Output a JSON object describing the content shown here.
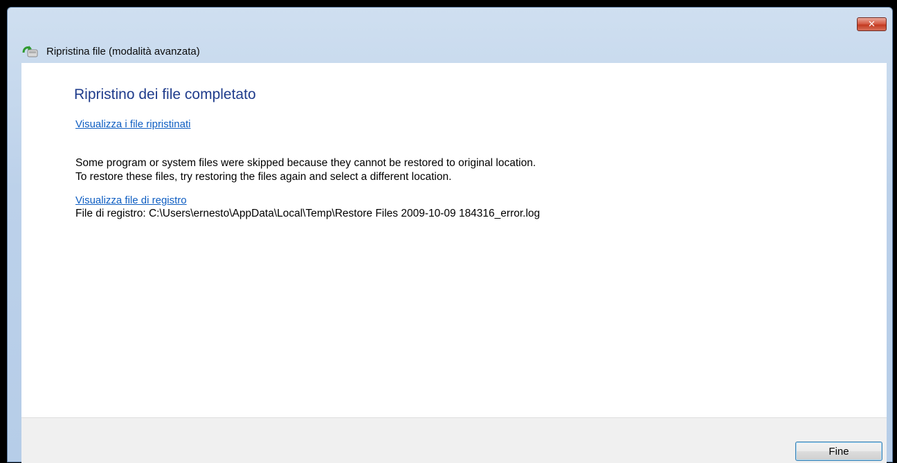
{
  "window": {
    "title": "Ripristina file (modalità avanzata)",
    "close_label": "✕"
  },
  "main": {
    "heading": "Ripristino dei file completato",
    "view_restored_link": "Visualizza i file ripristinati",
    "message_line1": "Some program or system files were skipped because they cannot be restored to original location.",
    "message_line2": "To restore these files, try restoring the files again and select a different location.",
    "view_log_link": "Visualizza file di registro",
    "log_path": "File di registro: C:\\Users\\ernesto\\AppData\\Local\\Temp\\Restore Files 2009-10-09 184316_error.log"
  },
  "footer": {
    "finish_label": "Fine"
  },
  "icons": {
    "app_icon": "restore-files-icon",
    "close_icon": "close-icon"
  },
  "colors": {
    "heading": "#1f3c8c",
    "link": "#0f5ec2",
    "close_button": "#c2391f"
  }
}
